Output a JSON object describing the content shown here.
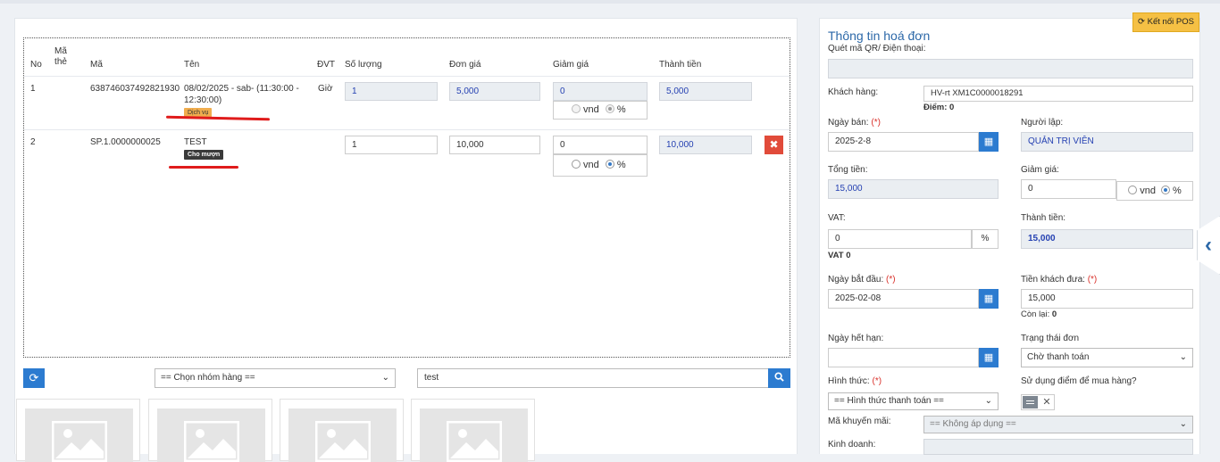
{
  "table": {
    "headers": {
      "no": "No",
      "card_code": "Mã thẻ",
      "code": "Mã",
      "name": "Tên",
      "unit": "ĐVT",
      "quantity": "Số lượng",
      "unit_price": "Đơn giá",
      "discount": "Giảm giá",
      "total": "Thành tiền"
    },
    "rows": [
      {
        "no": "1",
        "code": "638746037492821930",
        "name_line1": "08/02/2025 - sab- (11:30:00 -",
        "name_line2": "12:30:00)",
        "badge": "Dịch vụ",
        "unit": "Giờ",
        "quantity": "1",
        "unit_price": "5,000",
        "discount": "0",
        "radio_vnd": "vnd",
        "radio_pct": "%",
        "total": "5,000"
      },
      {
        "no": "2",
        "code": "SP.1.0000000025",
        "name_line1": "TEST",
        "badge": "Cho mượn",
        "unit": "",
        "quantity": "1",
        "unit_price": "10,000",
        "discount": "0",
        "radio_vnd": "vnd",
        "radio_pct": "%",
        "total": "10,000",
        "delete_icon": "close-icon"
      }
    ]
  },
  "filters": {
    "refresh_icon": "refresh-icon",
    "group_select": "== Chọn nhóm hàng ==",
    "search_value": "test",
    "search_icon": "search-icon"
  },
  "product_cards": [
    {
      "icon": "image-placeholder-icon"
    },
    {
      "icon": "image-placeholder-icon"
    },
    {
      "icon": "image-placeholder-icon"
    },
    {
      "icon": "image-placeholder-icon"
    }
  ],
  "invoice": {
    "pos_button": "Kết nối POS",
    "title": "Thông tin hoá đơn",
    "qr_label": "Quét mã QR/ Điện thoại:",
    "qr_value": "",
    "customer_label": "Khách hàng:",
    "customer_value": "HV-rt XM1C0000018291",
    "points_label": "Điểm:",
    "points_value": "0",
    "sale_date_label": "Ngày bán:",
    "sale_date_value": "2025-2-8",
    "creator_label": "Người lập:",
    "creator_value": "QUẢN TRỊ VIÊN",
    "total_label": "Tổng tiền:",
    "total_value": "15,000",
    "discount_label": "Giảm giá:",
    "discount_value": "0",
    "radio_vnd": "vnd",
    "radio_pct": "%",
    "vat_label": "VAT:",
    "vat_value": "0",
    "vat_unit": "%",
    "vat_sub_label": "VAT",
    "vat_sub_value": "0",
    "amount_label": "Thành tiền:",
    "amount_value": "15,000",
    "start_date_label": "Ngày bắt đầu:",
    "start_date_value": "2025-02-08",
    "paid_label": "Tiền khách đưa:",
    "paid_value": "15,000",
    "remaining_label": "Còn lại:",
    "remaining_value": "0",
    "expiry_label": "Ngày hết hạn:",
    "expiry_value": "",
    "status_label": "Trạng thái đơn",
    "status_value": "Chờ thanh toán",
    "payment_label": "Hình thức:",
    "payment_value": "== Hình thức thanh toán ==",
    "use_points_label": "Sử dụng điểm để mua hàng?",
    "promo_label": "Mã khuyến mãi:",
    "promo_value": "== Không áp dụng ==",
    "business_label": "Kinh doanh:",
    "business_value": "",
    "required_mark": "(*)"
  },
  "colors": {
    "accent_blue": "#2c7bd0",
    "pos_yellow": "#f5c044",
    "delete_red": "#e14b3a",
    "annotation_red": "#e01b1b"
  }
}
